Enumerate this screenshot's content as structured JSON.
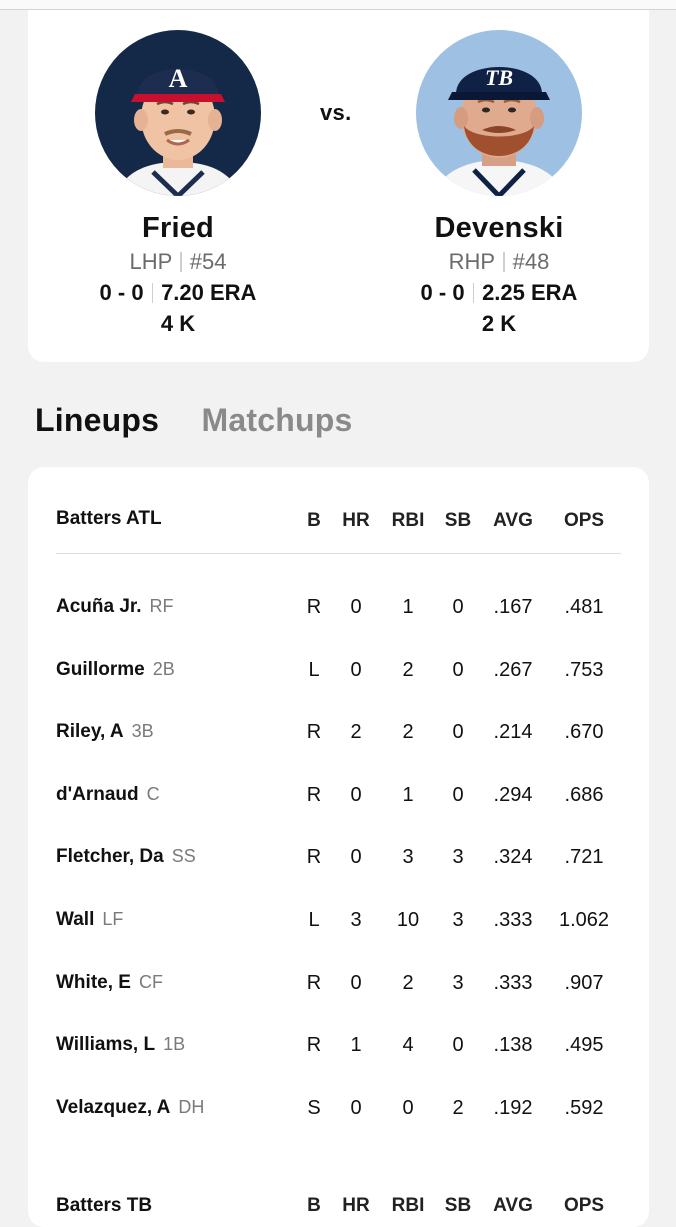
{
  "pitchers": {
    "vs_label": "vs.",
    "away": {
      "name": "Fried",
      "hand": "LHP",
      "number": "#54",
      "record": "0 - 0",
      "era": "7.20 ERA",
      "strikeouts": "4 K",
      "cap_logo": "A",
      "avatar_bg": "#142848",
      "cap_color": "#1c2d4f"
    },
    "home": {
      "name": "Devenski",
      "hand": "RHP",
      "number": "#48",
      "record": "0 - 0",
      "era": "2.25 ERA",
      "strikeouts": "2 K",
      "cap_logo": "TB",
      "avatar_bg": "#9dc0e3",
      "cap_color": "#0f2145"
    }
  },
  "tabs": [
    {
      "label": "Lineups",
      "active": true
    },
    {
      "label": "Matchups",
      "active": false
    }
  ],
  "lineup": {
    "team_label": "Batters ATL",
    "columns": [
      "B",
      "HR",
      "RBI",
      "SB",
      "AVG",
      "OPS"
    ],
    "rows": [
      {
        "name": "Acuña Jr.",
        "pos": "RF",
        "b": "R",
        "hr": "0",
        "rbi": "1",
        "sb": "0",
        "avg": ".167",
        "ops": ".481"
      },
      {
        "name": "Guillorme",
        "pos": "2B",
        "b": "L",
        "hr": "0",
        "rbi": "2",
        "sb": "0",
        "avg": ".267",
        "ops": ".753"
      },
      {
        "name": "Riley, A",
        "pos": "3B",
        "b": "R",
        "hr": "2",
        "rbi": "2",
        "sb": "0",
        "avg": ".214",
        "ops": ".670"
      },
      {
        "name": "d'Arnaud",
        "pos": "C",
        "b": "R",
        "hr": "0",
        "rbi": "1",
        "sb": "0",
        "avg": ".294",
        "ops": ".686"
      },
      {
        "name": "Fletcher, Da",
        "pos": "SS",
        "b": "R",
        "hr": "0",
        "rbi": "3",
        "sb": "3",
        "avg": ".324",
        "ops": ".721"
      },
      {
        "name": "Wall",
        "pos": "LF",
        "b": "L",
        "hr": "3",
        "rbi": "10",
        "sb": "3",
        "avg": ".333",
        "ops": "1.062"
      },
      {
        "name": "White, E",
        "pos": "CF",
        "b": "R",
        "hr": "0",
        "rbi": "2",
        "sb": "3",
        "avg": ".333",
        "ops": ".907"
      },
      {
        "name": "Williams, L",
        "pos": "1B",
        "b": "R",
        "hr": "1",
        "rbi": "4",
        "sb": "0",
        "avg": ".138",
        "ops": ".495"
      },
      {
        "name": "Velazquez, A",
        "pos": "DH",
        "b": "S",
        "hr": "0",
        "rbi": "0",
        "sb": "2",
        "avg": ".192",
        "ops": ".592"
      }
    ]
  },
  "next_lineup": {
    "team_label": "Batters TB",
    "columns": [
      "B",
      "HR",
      "RBI",
      "SB",
      "AVG",
      "OPS"
    ]
  }
}
